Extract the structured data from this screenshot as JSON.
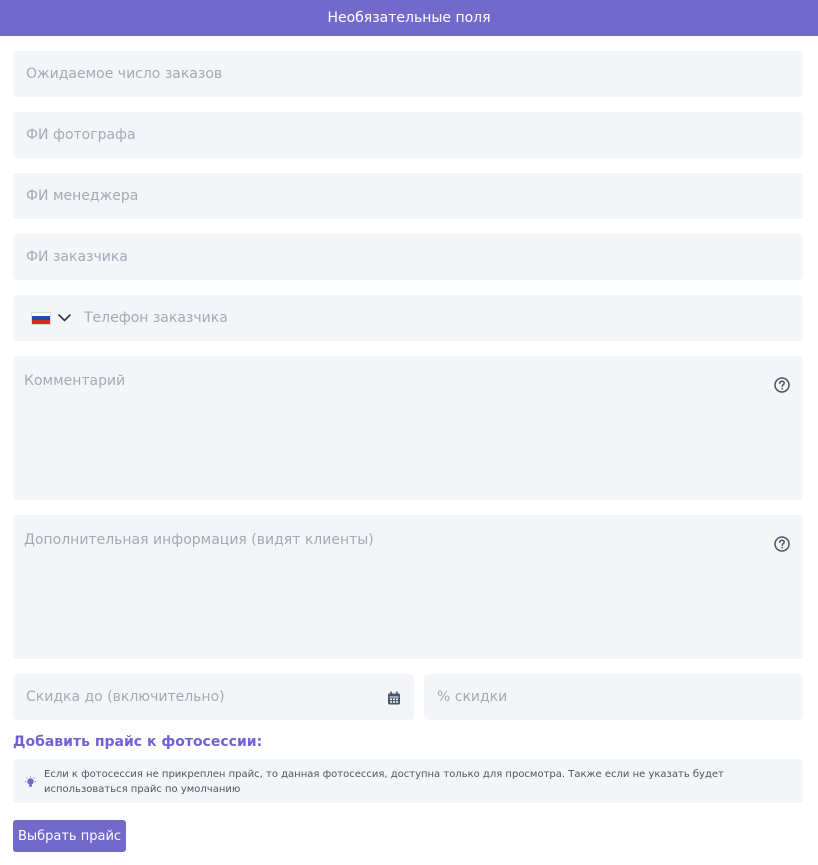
{
  "header": {
    "title": "Необязательные поля"
  },
  "fields": {
    "expected_orders": {
      "placeholder": "Ожидаемое число заказов",
      "value": ""
    },
    "photographer": {
      "placeholder": "ФИ фотографа",
      "value": ""
    },
    "manager": {
      "placeholder": "ФИ менеджера",
      "value": ""
    },
    "customer": {
      "placeholder": "ФИ заказчика",
      "value": ""
    },
    "phone": {
      "placeholder": "Телефон заказчика",
      "value": "",
      "country_flag": "russia-flag-icon"
    },
    "comment": {
      "placeholder": "Комментарий",
      "value": ""
    },
    "extra_info": {
      "placeholder": "Дополнительная информация (видят клиенты)",
      "value": ""
    },
    "discount_until": {
      "placeholder": "Скидка до (включительно)",
      "value": ""
    },
    "discount_percent": {
      "placeholder": "% скидки",
      "value": ""
    }
  },
  "price": {
    "add_label": "Добавить прайс к фотосессии:",
    "info_text": "Если к фотосессия не прикреплен прайс, то данная фотосессия, доступна только для просмотра. Также если не указать будет использоваться прайс по умолчанию",
    "select_button": "Выбрать прайс"
  },
  "colors": {
    "accent": "#7369cb",
    "link": "#6f63d4",
    "field_bg": "#f4f5f8",
    "placeholder": "#a3a9b6"
  }
}
